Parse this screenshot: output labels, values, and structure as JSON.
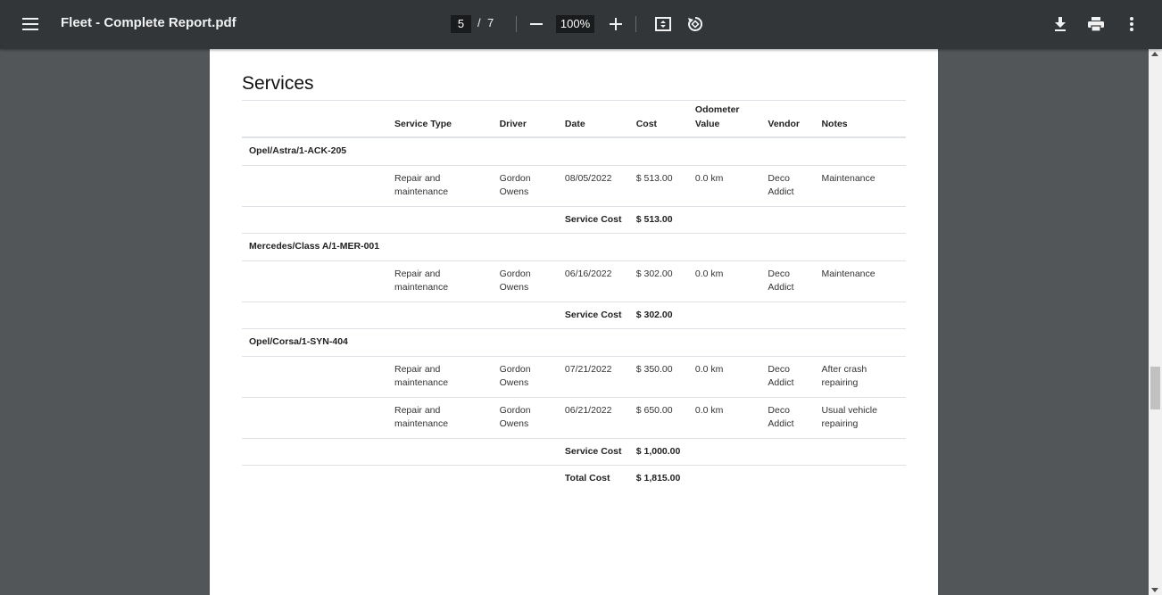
{
  "toolbar": {
    "title": "Fleet - Complete Report.pdf",
    "current_page": "5",
    "page_separator": "/",
    "total_pages": "7",
    "zoom": "100%",
    "icons": [
      "menu-icon",
      "zoom-out-icon",
      "zoom-in-icon",
      "fit-page-icon",
      "rotate-icon",
      "download-icon",
      "print-icon",
      "more-vert-icon"
    ]
  },
  "report": {
    "heading": "Services",
    "columns": [
      "",
      "Service Type",
      "Driver",
      "Date",
      "Cost",
      "Odometer Value",
      "Vendor",
      "Notes"
    ],
    "groups": [
      {
        "vehicle": "Opel/Astra/1-ACK-205",
        "rows": [
          {
            "service_type": "Repair and maintenance",
            "driver": "Gordon Owens",
            "date": "08/05/2022",
            "cost": "$ 513.00",
            "odometer": "0.0 km",
            "vendor": "Deco Addict",
            "notes": "Maintenance"
          }
        ],
        "subtotal_label": "Service Cost",
        "subtotal": "$ 513.00"
      },
      {
        "vehicle": "Mercedes/Class A/1-MER-001",
        "rows": [
          {
            "service_type": "Repair and maintenance",
            "driver": "Gordon Owens",
            "date": "06/16/2022",
            "cost": "$ 302.00",
            "odometer": "0.0 km",
            "vendor": "Deco Addict",
            "notes": "Maintenance"
          }
        ],
        "subtotal_label": "Service Cost",
        "subtotal": "$ 302.00"
      },
      {
        "vehicle": "Opel/Corsa/1-SYN-404",
        "rows": [
          {
            "service_type": "Repair and maintenance",
            "driver": "Gordon Owens",
            "date": "07/21/2022",
            "cost": "$ 350.00",
            "odometer": "0.0 km",
            "vendor": "Deco Addict",
            "notes": "After crash repairing"
          },
          {
            "service_type": "Repair and maintenance",
            "driver": "Gordon Owens",
            "date": "06/21/2022",
            "cost": "$ 650.00",
            "odometer": "0.0 km",
            "vendor": "Deco Addict",
            "notes": "Usual vehicle repairing"
          }
        ],
        "subtotal_label": "Service Cost",
        "subtotal": "$ 1,000.00"
      }
    ],
    "total_label": "Total Cost",
    "total": "$ 1,815.00"
  }
}
